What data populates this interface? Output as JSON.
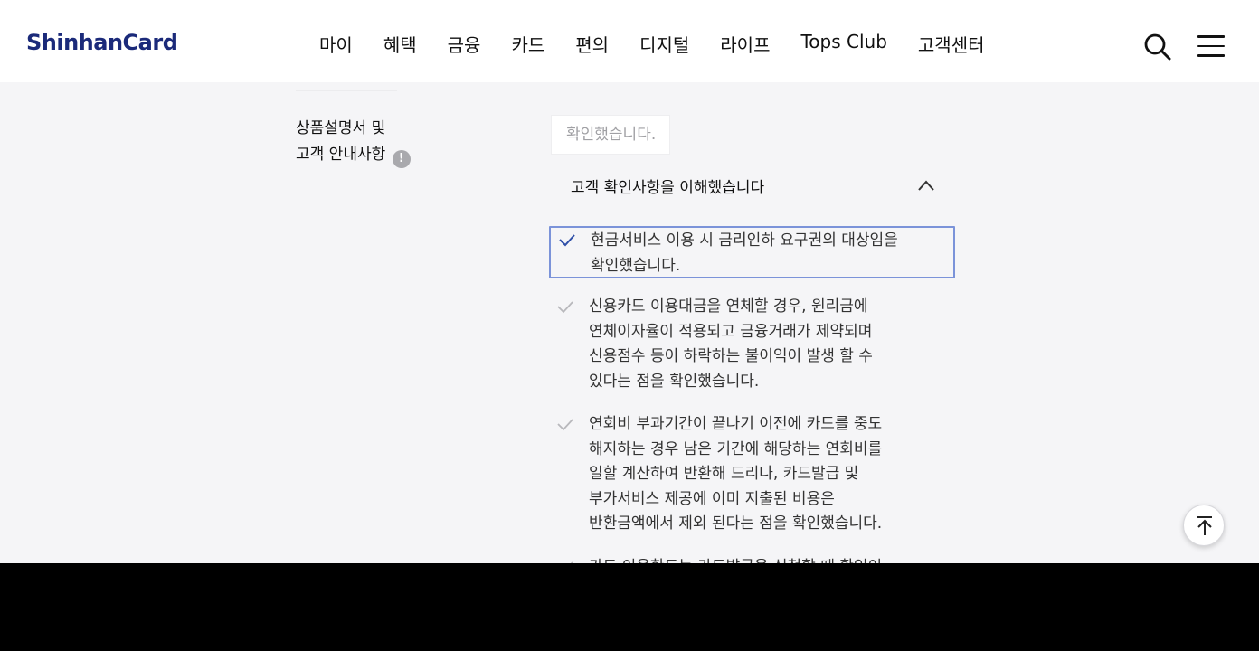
{
  "header": {
    "logo_text": "ShinhanCard",
    "nav": [
      "마이",
      "혜택",
      "금융",
      "카드",
      "편의",
      "디지털",
      "라이프",
      "Tops Club",
      "고객센터"
    ]
  },
  "section": {
    "label_line1": "상품설명서 및",
    "label_line2": "고객 안내사항",
    "info_icon_text": "!"
  },
  "confirm_chip": "확인했습니다.",
  "accordion": {
    "title": "고객 확인사항을 이해했습니다",
    "state": "expanded"
  },
  "check_items": [
    {
      "text": "현금서비스 이용 시 금리인하 요구권의 대상임을\n확인했습니다.",
      "checked": true,
      "focused": true
    },
    {
      "text": "신용카드 이용대금을 연체할 경우, 원리금에\n연체이자율이 적용되고 금융거래가 제약되며\n신용점수 등이 하락하는 불이익이 발생 할 수\n있다는 점을 확인했습니다.",
      "checked": false
    },
    {
      "text": "연회비 부과기간이 끝나기 이전에 카드를 중도\n해지하는 경우 남은 기간에 해당하는 연회비를\n일할 계산하여 반환해 드리나, 카드발급 및\n부가서비스 제공에 이미 지출된 비용은\n반환금액에서 제외 된다는 점을 확인했습니다.",
      "checked": false
    },
    {
      "text": "카드 이용한도는 카드발급을 신청할 때 확인이",
      "checked": false
    }
  ],
  "colors": {
    "brand": "#1b2a7a",
    "focus_border": "#7b93d9",
    "check_active": "#2f4fa8",
    "check_inactive": "#b8b8bc"
  }
}
